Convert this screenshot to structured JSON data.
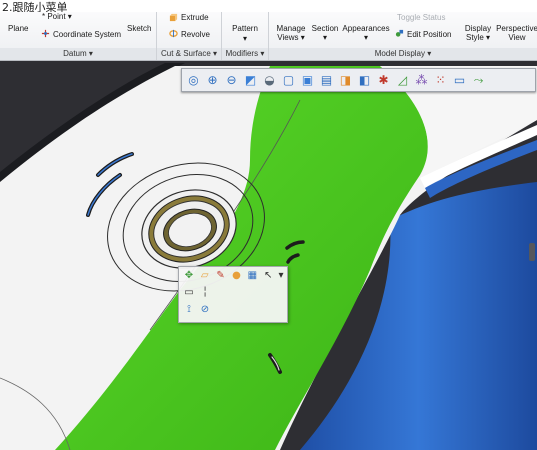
{
  "caption": "2.跟随小菜单",
  "ribbon": {
    "datum": {
      "plane": "Plane",
      "point": "* Point ▾",
      "coord": "Coordinate System",
      "sketch": "Sketch",
      "label": "Datum ▾"
    },
    "cut_surface": {
      "extrude": "Extrude",
      "revolve": "Revolve",
      "label": "Cut & Surface ▾"
    },
    "modifiers": {
      "pattern": "Pattern",
      "pattern_arrow": "▾",
      "label": "Modifiers ▾"
    },
    "model_display": {
      "manage_views": "Manage\nViews ▾",
      "section": "Section\n▾",
      "appearances": "Appearances\n▾",
      "toggle_status": "Toggle Status",
      "edit_position": "Edit Position",
      "display_style": "Display\nStyle ▾",
      "perspective_view": "Perspective\nView",
      "label": "Model Display ▾"
    },
    "colors": {
      "accent_blue": "#2f6fc0",
      "accent_orange": "#e8a03a",
      "accent_green": "#3f9a3b"
    }
  },
  "view_toolbar": {
    "icons": [
      "refit-icon",
      "zoom-in-icon",
      "zoom-out-icon",
      "repaint-icon",
      "display-style-icon",
      "saved-orientations-icon",
      "view-manager-icon",
      "perspective-icon",
      "section-icon",
      "annotation-display-icon",
      "datum-display-icon",
      "spin-center-icon",
      "datum-points-icon",
      "csys-display-icon",
      "sketch-icon",
      "tangent-edges-icon"
    ],
    "glyphs": [
      "◎",
      "⊕",
      "⊖",
      "◩",
      "◒",
      "▢",
      "▣",
      "▤",
      "◨",
      "◧",
      "✱",
      "◿",
      "⁂",
      "⁙",
      "▭",
      "⤳"
    ]
  },
  "mini_toolbar": {
    "row1": {
      "icons": [
        "sketch-icon",
        "open-folder-icon",
        "color-brush-icon",
        "appearance-icon",
        "table-icon",
        "select-filter-icon"
      ],
      "glyphs": [
        "✥",
        "▱",
        "✎",
        "●",
        "▦",
        "↖"
      ],
      "dropdown": "▾"
    },
    "row2": {
      "icons": [
        "rectangle-icon",
        "dashed-line-icon"
      ],
      "glyphs": [
        "▭",
        "╎"
      ]
    },
    "row3": {
      "icons": [
        "measure-icon",
        "hide-icon"
      ],
      "glyphs": [
        "⟟",
        "⊘"
      ]
    }
  },
  "model": {
    "body_color": "#f2f2f2",
    "band_color": "#4ccb1a",
    "shell_color": "#2d66c4",
    "background_color": "#2e2e33"
  }
}
